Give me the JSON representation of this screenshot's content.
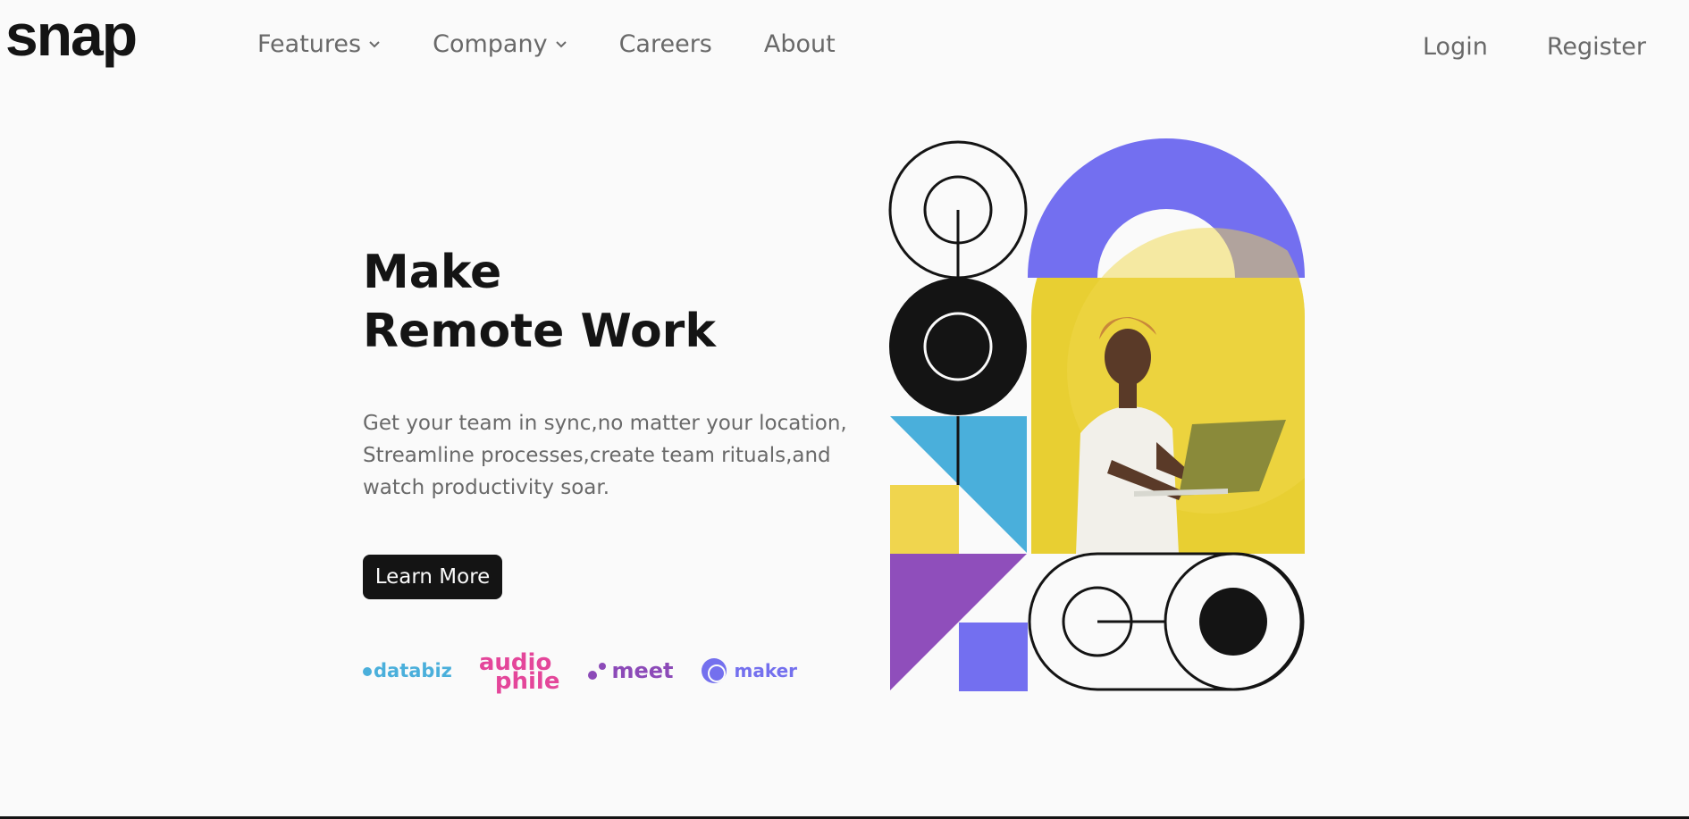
{
  "brand": {
    "logo_text": "snap"
  },
  "nav": {
    "items": [
      {
        "label": "Features",
        "has_dropdown": true,
        "icon": "chevron-down-icon"
      },
      {
        "label": "Company",
        "has_dropdown": true,
        "icon": "chevron-down-icon"
      },
      {
        "label": "Careers",
        "has_dropdown": false
      },
      {
        "label": "About",
        "has_dropdown": false
      }
    ]
  },
  "auth": {
    "login_label": "Login",
    "register_label": "Register"
  },
  "hero": {
    "title_line1": "Make",
    "title_line2": "Remote Work",
    "description_line1": "Get your team in sync,no matter your location,",
    "description_line2": "Streamline processes,create team rituals,and",
    "description_line3": "watch productivity soar.",
    "cta_label": "Learn More"
  },
  "clients": [
    {
      "name": "databiz",
      "color": "#4aafdb"
    },
    {
      "name_line1": "audio",
      "name_line2": "phile",
      "color": "#e4469a"
    },
    {
      "name": "meet",
      "color": "#8c4ab8"
    },
    {
      "name": "maker",
      "color": "#7470ee"
    }
  ],
  "colors": {
    "text_dark": "#141414",
    "text_gray": "#696969",
    "background": "#fafafa",
    "purple": "#736ff0",
    "blue": "#4aafdb",
    "yellow": "#f0d54e",
    "violet": "#8f4ebb",
    "photo_yellow": "#e8cf32"
  }
}
